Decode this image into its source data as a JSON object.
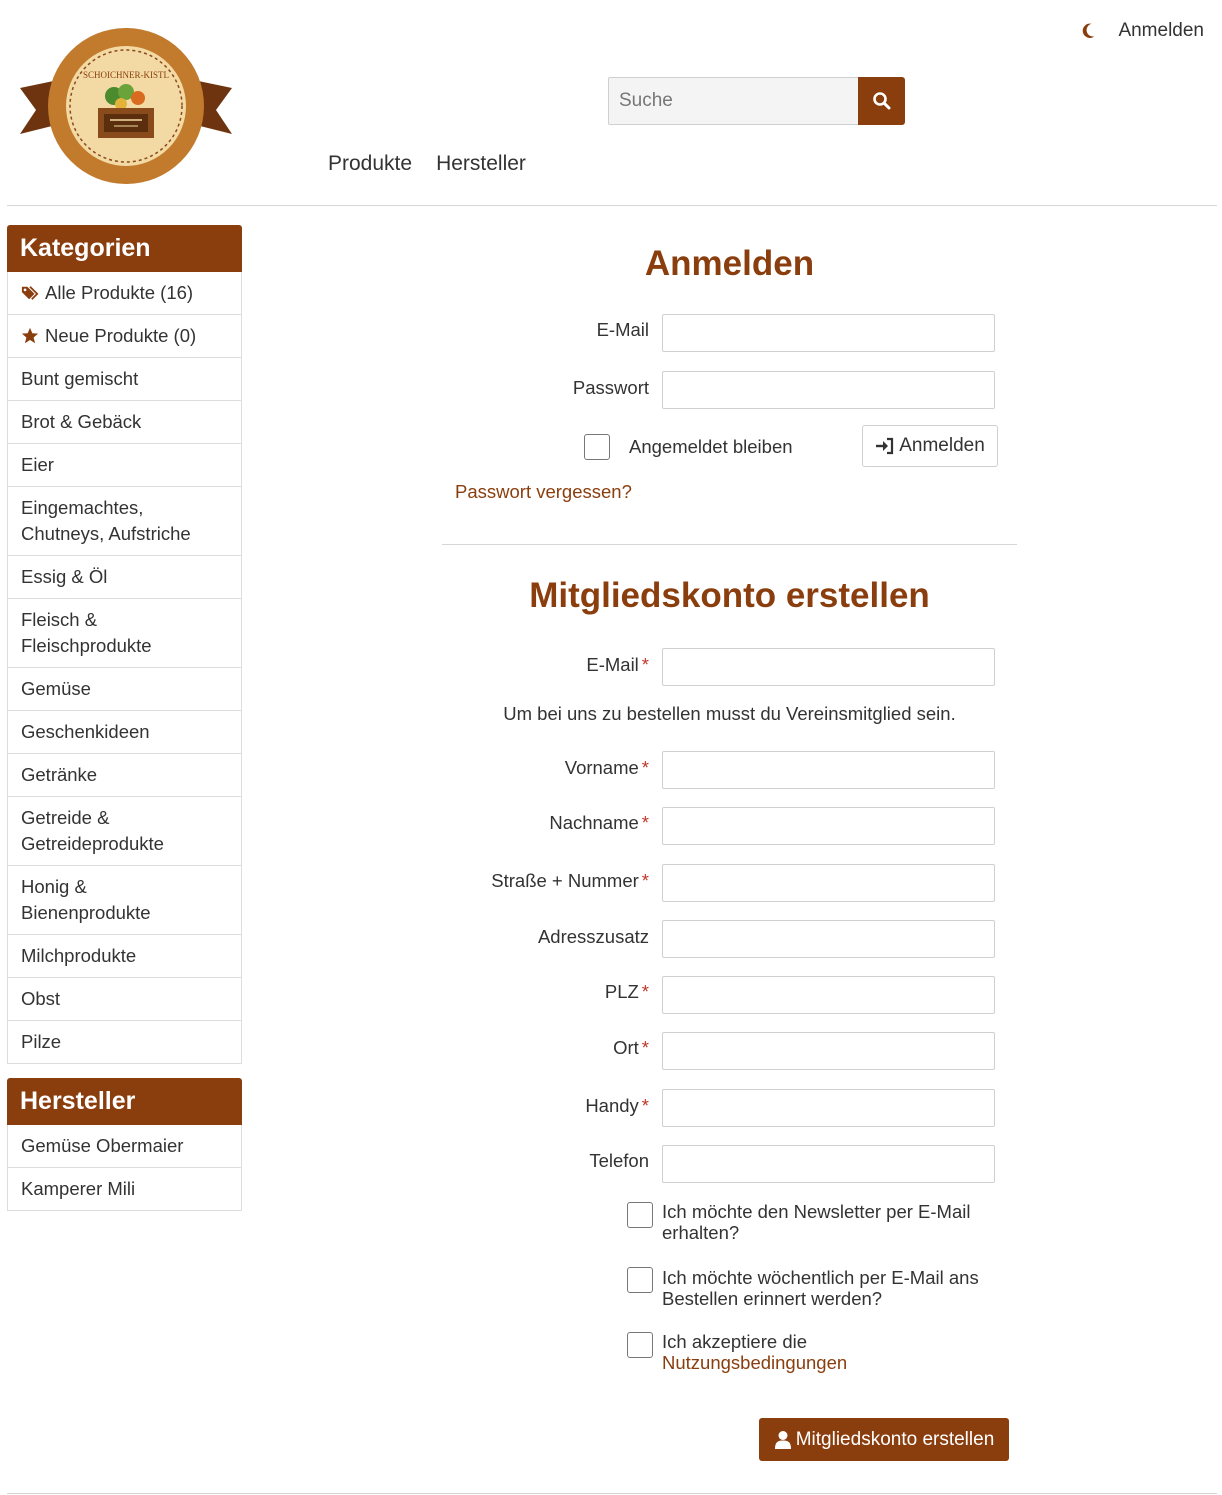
{
  "header": {
    "login_link": "Anmelden",
    "search_placeholder": "Suche",
    "logo_text": "SCHOICHNER-KISTL",
    "nav": [
      "Produkte",
      "Hersteller"
    ]
  },
  "sidebar": {
    "categories_title": "Kategorien",
    "categories": [
      {
        "label": "Alle Produkte (16)",
        "icon": "tags-icon"
      },
      {
        "label": "Neue Produkte (0)",
        "icon": "star-icon"
      },
      {
        "label": "Bunt gemischt"
      },
      {
        "label": "Brot & Gebäck"
      },
      {
        "label": "Eier"
      },
      {
        "label": "Eingemachtes, Chutneys, Aufstriche"
      },
      {
        "label": "Essig & Öl"
      },
      {
        "label": "Fleisch & Fleischprodukte"
      },
      {
        "label": "Gemüse"
      },
      {
        "label": "Geschenkideen"
      },
      {
        "label": "Getränke"
      },
      {
        "label": "Getreide & Getreideprodukte"
      },
      {
        "label": "Honig & Bienenprodukte"
      },
      {
        "label": "Milchprodukte"
      },
      {
        "label": "Obst"
      },
      {
        "label": "Pilze"
      }
    ],
    "manufacturers_title": "Hersteller",
    "manufacturers": [
      "Gemüse Obermaier",
      "Kamperer Mili"
    ]
  },
  "login": {
    "title": "Anmelden",
    "email_label": "E-Mail",
    "password_label": "Passwort",
    "remember_label": "Angemeldet bleiben",
    "submit_label": "Anmelden",
    "forgot_label": "Passwort vergessen?"
  },
  "register": {
    "title": "Mitgliedskonto erstellen",
    "required_mark": "*",
    "email_label": "E-Mail",
    "notice": "Um bei uns zu bestellen musst du Vereinsmitglied sein.",
    "firstname_label": "Vorname",
    "lastname_label": "Nachname",
    "street_label": "Straße + Nummer",
    "address_extra_label": "Adresszusatz",
    "zip_label": "PLZ",
    "city_label": "Ort",
    "mobile_label": "Handy",
    "phone_label": "Telefon",
    "newsletter_label": "Ich möchte den Newsletter per E-Mail erhalten?",
    "reminder_label": "Ich möchte wöchentlich per E-Mail ans Bestellen erinnert werden?",
    "terms_prefix": "Ich akzeptiere die",
    "terms_link": "Nutzungsbedingungen",
    "submit_label": "Mitgliedskonto erstellen"
  },
  "colors": {
    "brand": "#8a3e0e",
    "required": "#c0392b"
  }
}
